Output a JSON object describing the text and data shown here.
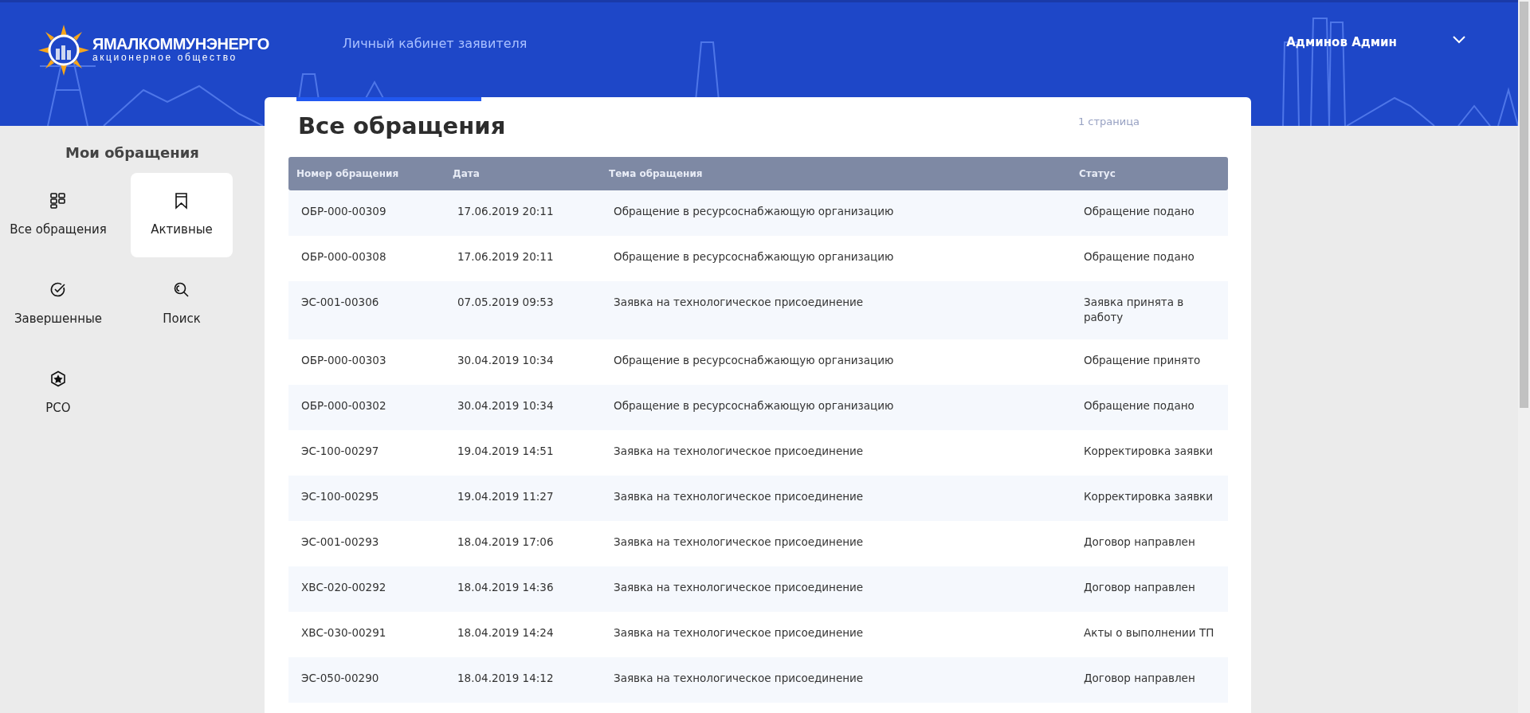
{
  "header": {
    "logo": {
      "name": "ЯМАЛКОММУНЭНЕРГО",
      "subtitle": "акционерное общество"
    },
    "portal_title": "Личный кабинет заявителя",
    "user_name": "Админов Админ"
  },
  "sidebar": {
    "title": "Мои обращения",
    "items": [
      {
        "label": "Все обращения",
        "selected": false
      },
      {
        "label": "Активные",
        "selected": true
      },
      {
        "label": "Завершенные",
        "selected": false
      },
      {
        "label": "Поиск",
        "selected": false
      },
      {
        "label": "РСО",
        "selected": false
      }
    ]
  },
  "main": {
    "title": "Все обращения",
    "page_info": "1 страница",
    "table": {
      "columns": [
        "Номер обращения",
        "Дата",
        "Тема обращения",
        "Статус"
      ],
      "rows": [
        [
          "ОБР-000-00309",
          "17.06.2019 20:11",
          "Обращение в ресурсоснабжающую организацию",
          "Обращение подано"
        ],
        [
          "ОБР-000-00308",
          "17.06.2019 20:11",
          "Обращение в ресурсоснабжающую организацию",
          "Обращение подано"
        ],
        [
          "ЭС-001-00306",
          "07.05.2019 09:53",
          "Заявка на технологическое присоединение",
          "Заявка принята в работу"
        ],
        [
          "ОБР-000-00303",
          "30.04.2019 10:34",
          "Обращение в ресурсоснабжающую организацию",
          "Обращение принято"
        ],
        [
          "ОБР-000-00302",
          "30.04.2019 10:34",
          "Обращение в ресурсоснабжающую организацию",
          "Обращение подано"
        ],
        [
          "ЭС-100-00297",
          "19.04.2019 14:51",
          "Заявка на технологическое присоединение",
          "Корректировка заявки"
        ],
        [
          "ЭС-100-00295",
          "19.04.2019 11:27",
          "Заявка на технологическое присоединение",
          "Корректировка заявки"
        ],
        [
          "ЭС-001-00293",
          "18.04.2019 17:06",
          "Заявка на технологическое присоединение",
          "Договор направлен"
        ],
        [
          "ХВС-020-00292",
          "18.04.2019 14:36",
          "Заявка на технологическое присоединение",
          "Договор направлен"
        ],
        [
          "ХВС-030-00291",
          "18.04.2019 14:24",
          "Заявка на технологическое присоединение",
          "Акты о выполнении ТП"
        ],
        [
          "ЭС-050-00290",
          "18.04.2019 14:12",
          "Заявка на технологическое присоединение",
          "Договор направлен"
        ]
      ]
    }
  }
}
